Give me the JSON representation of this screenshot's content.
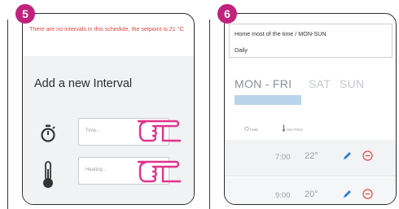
{
  "steps": [
    {
      "number": "5",
      "info_text": "There are no intervals in this schedule, the setpoint is 21 °C",
      "title": "Add a new Interval",
      "time_placeholder": "Time...",
      "heating_placeholder": "Heating..."
    },
    {
      "number": "6",
      "schedule_name": "Home most of the time / MON-SUN",
      "schedule_repeat": "Daily",
      "tabs": [
        "MON - FRI",
        "SAT",
        "SUN"
      ],
      "active_tab": "MON - FRI",
      "columns": {
        "time": "TIME",
        "heating": "HEATING"
      },
      "intervals": [
        {
          "time": "7:00",
          "temp": "22°"
        },
        {
          "time": "9:00",
          "temp": "20°"
        }
      ]
    }
  ],
  "colors": {
    "badge": "#c0227d",
    "info_text": "#e2453d",
    "accent_blue": "#2f7fd6",
    "remove_red": "#e2453d",
    "pointer": "#e0338a",
    "tab_underline": "#b9d4ea"
  },
  "icons": {
    "stopwatch": "stopwatch-icon",
    "thermometer": "thermometer-icon",
    "pointing_hand": "pointing-hand-icon",
    "edit": "pencil-icon",
    "remove": "minus-circle-icon"
  }
}
